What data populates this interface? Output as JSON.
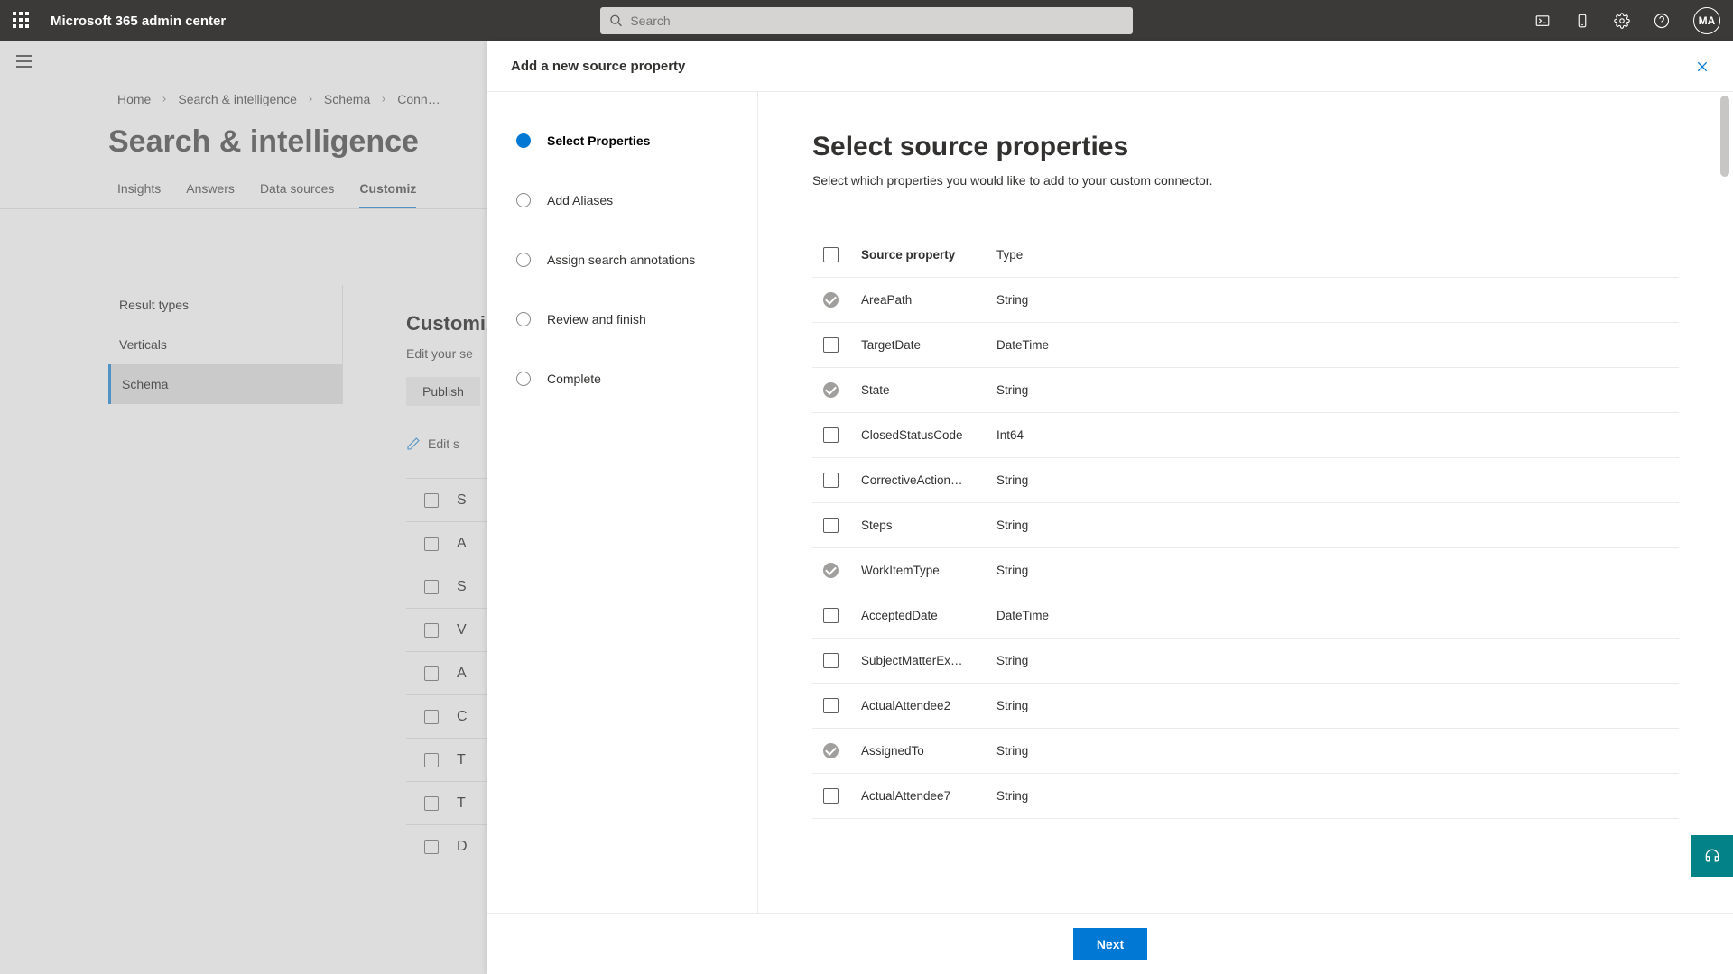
{
  "app": {
    "title": "Microsoft 365 admin center"
  },
  "search": {
    "placeholder": "Search"
  },
  "avatar": {
    "initials": "MA"
  },
  "breadcrumb": [
    "Home",
    "Search & intelligence",
    "Schema",
    "Conn…"
  ],
  "page": {
    "title": "Search & intelligence"
  },
  "tabs": [
    "Insights",
    "Answers",
    "Data sources",
    "Customiz"
  ],
  "active_tab_index": 3,
  "side_nav": [
    "Result types",
    "Verticals",
    "Schema"
  ],
  "side_nav_active_index": 2,
  "bg_main": {
    "heading": "Customiz",
    "desc": "Edit your se",
    "button": "Publish",
    "edit_label": "Edit s",
    "head_col": "S",
    "rows": [
      "A",
      "S",
      "V",
      "A",
      "C",
      "T",
      "T",
      "D"
    ]
  },
  "panel": {
    "title": "Add a new source property",
    "steps": [
      "Select Properties",
      "Add Aliases",
      "Assign search annotations",
      "Review and finish",
      "Complete"
    ],
    "active_step_index": 0,
    "main_title": "Select source properties",
    "subtitle": "Select which properties you would like to add to your custom connector.",
    "columns": {
      "name": "Source property",
      "type": "Type"
    },
    "properties": [
      {
        "name": "AreaPath",
        "type": "String",
        "checked": true
      },
      {
        "name": "TargetDate",
        "type": "DateTime",
        "checked": false
      },
      {
        "name": "State",
        "type": "String",
        "checked": true
      },
      {
        "name": "ClosedStatusCode",
        "type": "Int64",
        "checked": false
      },
      {
        "name": "CorrectiveAction…",
        "type": "String",
        "checked": false
      },
      {
        "name": "Steps",
        "type": "String",
        "checked": false
      },
      {
        "name": "WorkItemType",
        "type": "String",
        "checked": true
      },
      {
        "name": "AcceptedDate",
        "type": "DateTime",
        "checked": false
      },
      {
        "name": "SubjectMatterEx…",
        "type": "String",
        "checked": false
      },
      {
        "name": "ActualAttendee2",
        "type": "String",
        "checked": false
      },
      {
        "name": "AssignedTo",
        "type": "String",
        "checked": true
      },
      {
        "name": "ActualAttendee7",
        "type": "String",
        "checked": false
      }
    ],
    "next_label": "Next"
  }
}
